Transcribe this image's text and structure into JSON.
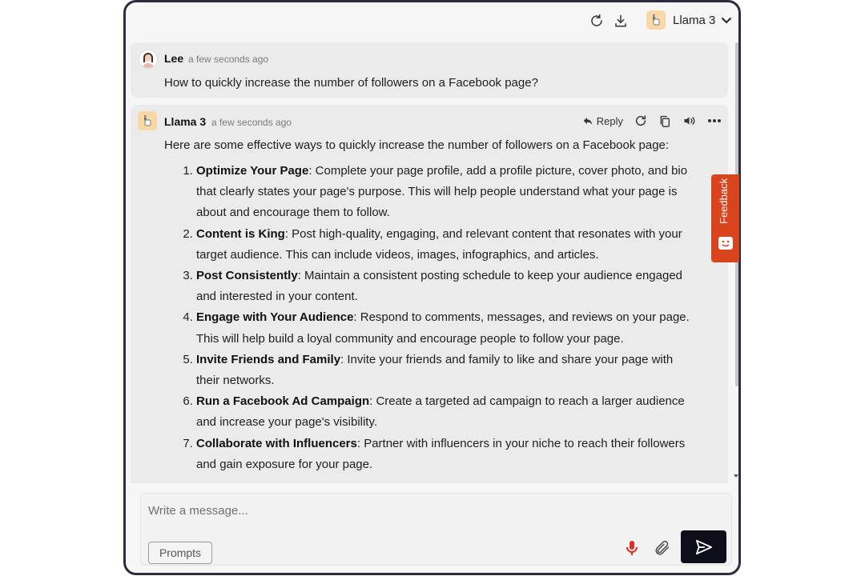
{
  "header": {
    "model_name": "Llama 3",
    "icons": [
      "refresh-icon",
      "download-icon",
      "llama-avatar-icon",
      "chevron-down-icon"
    ]
  },
  "messages": {
    "user": {
      "name": "Lee",
      "time": "a few seconds ago",
      "text": "How to quickly increase the number of followers on a Facebook page?"
    },
    "bot": {
      "name": "Llama 3",
      "time": "a few seconds ago",
      "reply_label": "Reply",
      "intro": "Here are some effective ways to quickly increase the number of followers on a Facebook page:",
      "items": [
        {
          "title": "Optimize Your Page",
          "body": ": Complete your page profile, add a profile picture, cover photo, and bio that clearly states your page's purpose. This will help people understand what your page is about and encourage them to follow."
        },
        {
          "title": "Content is King",
          "body": ": Post high-quality, engaging, and relevant content that resonates with your target audience. This can include videos, images, infographics, and articles."
        },
        {
          "title": "Post Consistently",
          "body": ": Maintain a consistent posting schedule to keep your audience engaged and interested in your content."
        },
        {
          "title": "Engage with Your Audience",
          "body": ": Respond to comments, messages, and reviews on your page. This will help build a loyal community and encourage people to follow your page."
        },
        {
          "title": "Invite Friends and Family",
          "body": ": Invite your friends and family to like and share your page with their networks."
        },
        {
          "title": "Run a Facebook Ad Campaign",
          "body": ": Create a targeted ad campaign to reach a larger audience and increase your page's visibility."
        },
        {
          "title": "Collaborate with Influencers",
          "body": ": Partner with influencers in your niche to reach their followers and gain exposure for your page."
        }
      ]
    }
  },
  "feedback": {
    "label": "Feedback"
  },
  "composer": {
    "placeholder": "Write a message...",
    "prompts_label": "Prompts"
  },
  "colors": {
    "window_border": "#2d2b40",
    "message_bg": "#ebebeb",
    "feedback_bg": "#d9441d",
    "send_bg": "#0e0e1b",
    "mic_red": "#d93025",
    "avatar_bg": "#f8d9a6"
  }
}
